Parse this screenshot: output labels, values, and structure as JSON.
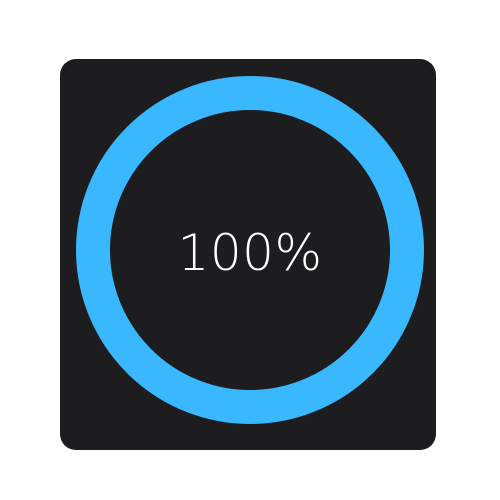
{
  "progress": {
    "value": 1,
    "label": "100%"
  },
  "colors": {
    "background": "#ffffff",
    "card": "#1d1d20",
    "ring": "#3ab8ff",
    "text": "#ffffff"
  }
}
